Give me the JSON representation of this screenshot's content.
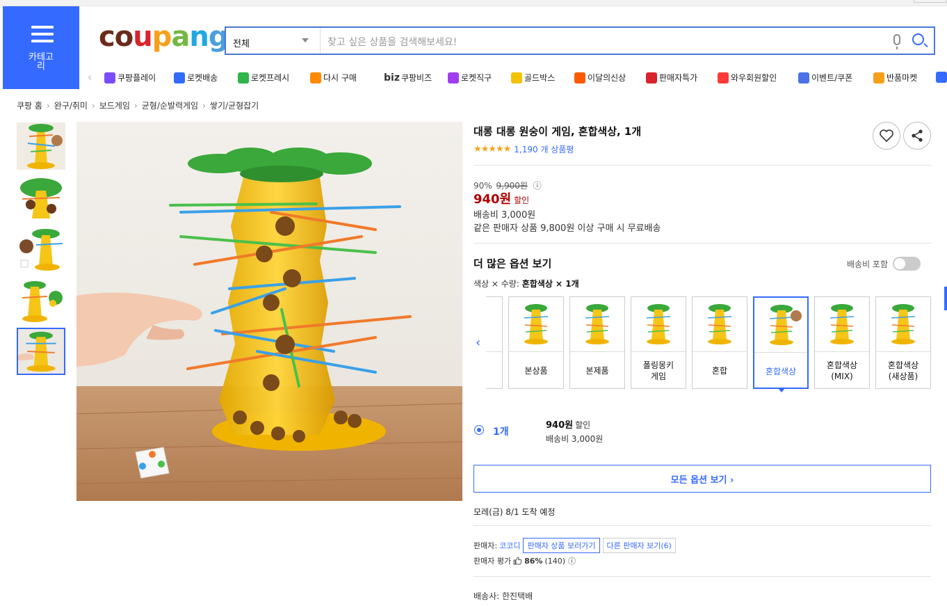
{
  "header": {
    "category_label": "카테고\n리",
    "logo_letters": [
      "c",
      "o",
      "u",
      "p",
      "a",
      "n",
      "g"
    ],
    "logo_colors": [
      "#6b2a1a",
      "#6b2a1a",
      "#d9232d",
      "#f6a01a",
      "#74b843",
      "#1fa9e0",
      "#4a9fdd"
    ],
    "search_scope": "전체",
    "search_placeholder": "찾고 싶은 상품을 검색해보세요!"
  },
  "nav": [
    {
      "label": "쿠팡플레이",
      "color": "#7a4cff"
    },
    {
      "label": "로켓배송",
      "color": "#346aff"
    },
    {
      "label": "로켓프레시",
      "color": "#2fb54a"
    },
    {
      "label": "다시 구매",
      "color": "#ff8a00"
    },
    {
      "label": "쿠팡비즈",
      "prefix": "biz",
      "color": "#333333"
    },
    {
      "label": "로켓직구",
      "color": "#a23cf0"
    },
    {
      "label": "골드박스",
      "color": "#f3c300"
    },
    {
      "label": "이달의신상",
      "color": "#ff5a00"
    },
    {
      "label": "판매자특가",
      "color": "#d9232d"
    },
    {
      "label": "와우회원할인",
      "color": "#ff3a3a"
    },
    {
      "label": "이벤트/쿠폰",
      "color": "#4a72e6"
    },
    {
      "label": "반품마켓",
      "color": "#f6a01a"
    }
  ],
  "breadcrumb": [
    "쿠팡 홈",
    "완구/취미",
    "보드게임",
    "균형/순발력게임",
    "쌓기/균형잡기"
  ],
  "product": {
    "title": "대롱 대롱 원숭이 게임, 혼합색상, 1개",
    "stars": "★★★★★",
    "review_count": "1,190 개 상품평",
    "discount_rate": "90%",
    "original_price": "9,900원",
    "info_icon": "ⓘ",
    "price": "940원",
    "sale_label": "할인",
    "shipping_fee": "배송비 3,000원",
    "free_shipping_note": "같은 판매자 상품 9,800원 이상 구매 시 무료배송"
  },
  "options": {
    "heading": "더 많은 옵션 보기",
    "shipping_included_label": "배송비 포함",
    "selection_prefix": "색상 × 수량: ",
    "selection_value": "혼합색상 × 1개",
    "cards": [
      {
        "label": "본상품"
      },
      {
        "label": "본제품"
      },
      {
        "label": "폴링몽키\n게임"
      },
      {
        "label": "혼합"
      },
      {
        "label": "혼합색상"
      },
      {
        "label": "혼합색상\n(MIX)"
      },
      {
        "label": "혼합색상\n(새상품)"
      }
    ],
    "selected_qty": "1개",
    "opt_price": "940원",
    "opt_sale": "할인",
    "opt_shipping": "배송비 3,000원",
    "all_options_button": "모든 옵션 보기 ›"
  },
  "delivery": {
    "arrival": "모레(금) 8/1 도착 예정",
    "seller_prefix": "판매자:",
    "seller_name": "코코디",
    "seller_products_link": "판매자 상품 보러가기",
    "other_sellers_link": "다른 판매자 보기(6)",
    "seller_rating_label": "판매자 평가",
    "seller_rating_value": "86%",
    "seller_rating_count": "(140)",
    "carrier": "배송사:  한진택배"
  }
}
